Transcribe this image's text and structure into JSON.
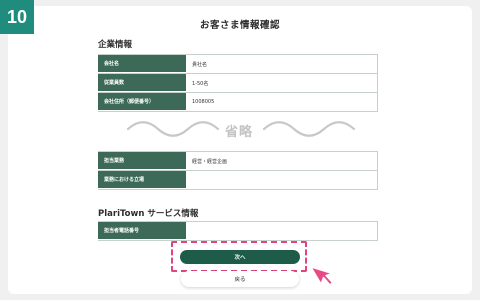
{
  "step_number": "10",
  "page_title": "お客さま情報確認",
  "company_section": {
    "title": "企業情報",
    "rows": [
      {
        "label": "会社名",
        "value": "貴社名"
      },
      {
        "label": "従業員数",
        "value": "1-50名"
      },
      {
        "label": "会社住所（郵便番号）",
        "value": "1008005"
      }
    ]
  },
  "omitted_text": "省略",
  "company_section_bottom": {
    "rows": [
      {
        "label": "担当業務",
        "value": "経営・経営企画"
      },
      {
        "label": "業務における立場",
        "value": ""
      }
    ]
  },
  "service_section": {
    "title": "PlariTown サービス情報",
    "rows": [
      {
        "label": "担当者電話番号",
        "value": ""
      }
    ]
  },
  "buttons": {
    "next_label": "次へ",
    "back_label": "戻る"
  },
  "colors": {
    "badge": "#1f8c7e",
    "label_bg": "#3d6a58",
    "primary_button": "#1e5b48",
    "highlight": "#e0457f"
  }
}
